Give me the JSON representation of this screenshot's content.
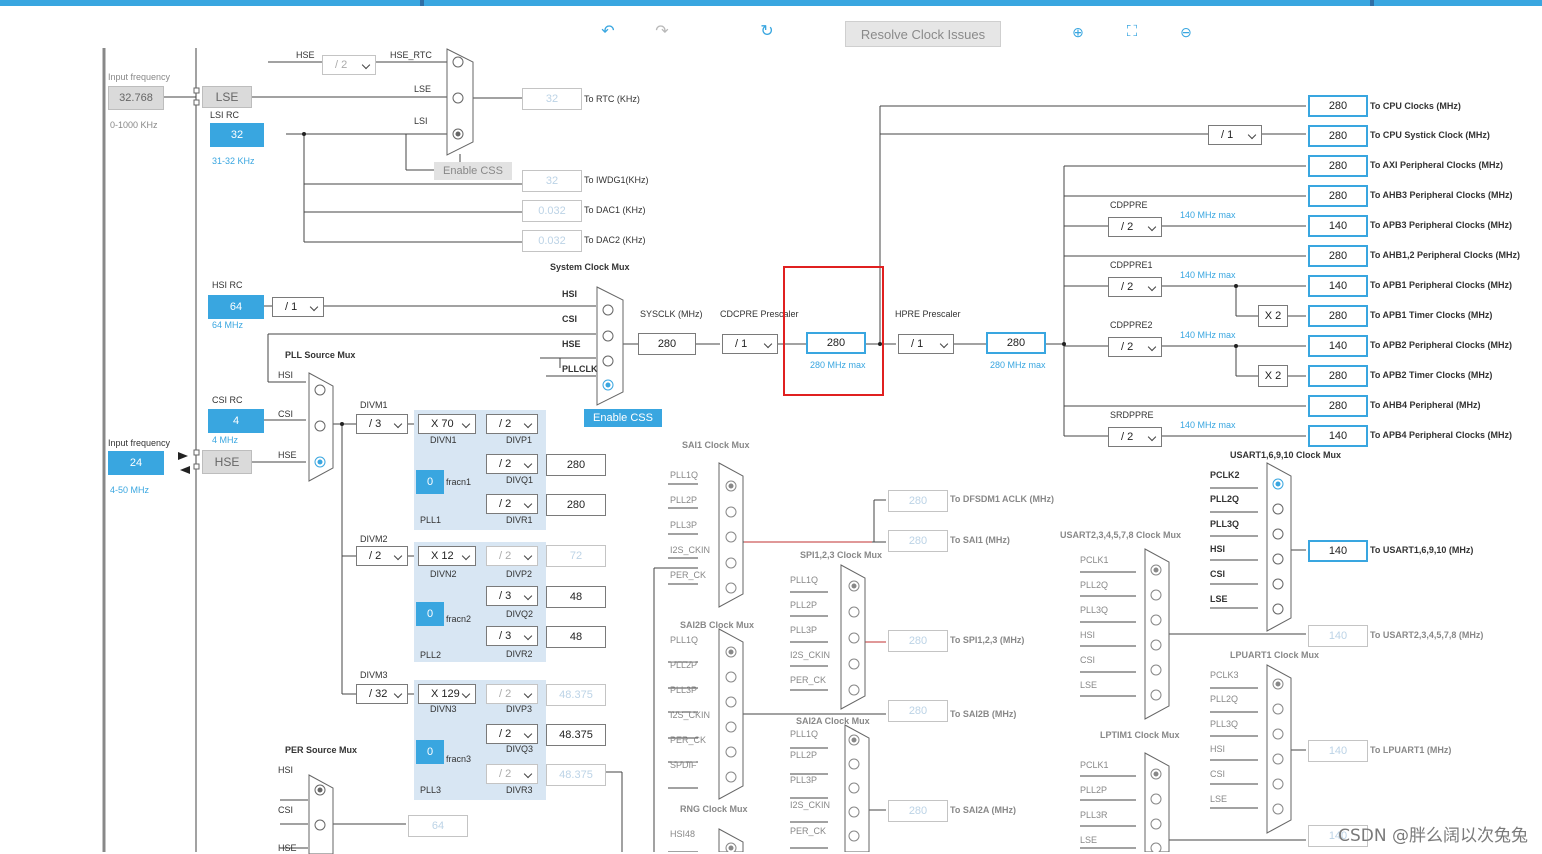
{
  "toolbar": {
    "undo_icon": "undo-icon",
    "redo_icon": "redo-icon",
    "refresh_icon": "refresh-icon",
    "resolve_label": "Resolve Clock Issues",
    "zoom_in_icon": "zoom-in-icon",
    "fit_icon": "fit-to-screen-icon",
    "zoom_out_icon": "zoom-out-icon"
  },
  "colors": {
    "accent": "#39a6e0",
    "highlight": "#e02020",
    "pll_bg": "#d8e6f3"
  },
  "lse": {
    "input_freq_label": "Input frequency",
    "value": "32.768",
    "range": "0-1000 KHz",
    "name": "LSE"
  },
  "lsi": {
    "label": "LSI RC",
    "value": "32",
    "range": "31-32 KHz"
  },
  "hse_in": {
    "input_freq_label": "Input frequency",
    "value": "24",
    "range": "4-50 MHz",
    "name": "HSE"
  },
  "hsi": {
    "label": "HSI RC",
    "value": "64",
    "range": "64 MHz",
    "div": "/ 1"
  },
  "csi": {
    "label": "CSI RC",
    "value": "4",
    "range": "4 MHz"
  },
  "rtc": {
    "hse_label": "HSE",
    "div": "/ 2",
    "hse_rtc": "HSE_RTC",
    "lse": "LSE",
    "lsi": "LSI",
    "enable_css": "Enable CSS",
    "value": "32",
    "out": "To RTC (KHz)"
  },
  "iwdg": {
    "value": "32",
    "out": "To IWDG1(KHz)"
  },
  "dac1": {
    "value": "0.032",
    "out": "To DAC1 (KHz)"
  },
  "dac2": {
    "value": "0.032",
    "out": "To DAC2 (KHz)"
  },
  "sysmux": {
    "title": "System Clock Mux",
    "in": [
      "HSI",
      "CSI",
      "HSE",
      "PLLCLK"
    ],
    "enable_css": "Enable CSS"
  },
  "sysclk": {
    "label": "SYSCLK (MHz)",
    "value": "280"
  },
  "cdcpre": {
    "label": "CDCPRE Prescaler",
    "div": "/ 1"
  },
  "cpu": {
    "value": "280",
    "max": "280 MHz max"
  },
  "hpre": {
    "label": "HPRE Prescaler",
    "div": "/ 1",
    "value": "280",
    "max": "280 MHz max"
  },
  "pllsrc": {
    "title": "PLL Source Mux",
    "in": [
      "HSI",
      "CSI",
      "HSE"
    ]
  },
  "pll1": {
    "divm_label": "DIVM1",
    "divm": "/ 3",
    "divn": "X 70",
    "divn_label": "DIVN1",
    "fracn": "0",
    "fracn_label": "fracn1",
    "name": "PLL1",
    "divp": "/ 2",
    "divp_label": "DIVP1",
    "divq": "/ 2",
    "divq_label": "DIVQ1",
    "divq_val": "280",
    "divr": "/ 2",
    "divr_label": "DIVR1",
    "divr_val": "280"
  },
  "pll2": {
    "divm_label": "DIVM2",
    "divm": "/ 2",
    "divn": "X 12",
    "divn_label": "DIVN2",
    "fracn": "0",
    "fracn_label": "fracn2",
    "name": "PLL2",
    "divp": "/ 2",
    "divp_label": "DIVP2",
    "divp_val": "72",
    "divq": "/ 3",
    "divq_label": "DIVQ2",
    "divq_val": "48",
    "divr": "/ 3",
    "divr_label": "DIVR2",
    "divr_val": "48"
  },
  "pll3": {
    "divm_label": "DIVM3",
    "divm": "/ 32",
    "divn": "X 129",
    "divn_label": "DIVN3",
    "fracn": "0",
    "fracn_label": "fracn3",
    "name": "PLL3",
    "divp": "/ 2",
    "divp_label": "DIVP3",
    "divp_val": "48.375",
    "divq": "/ 2",
    "divq_label": "DIVQ3",
    "divq_val": "48.375",
    "divr": "/ 2",
    "divr_label": "DIVR3",
    "divr_val": "48.375"
  },
  "persrc": {
    "title": "PER Source Mux",
    "in": [
      "HSI",
      "CSI",
      "HSE"
    ],
    "value": "64"
  },
  "outputs": [
    {
      "value": "280",
      "label": "To CPU Clocks (MHz)"
    },
    {
      "value": "280",
      "label": "To CPU Systick Clock (MHz)",
      "div": "/ 1"
    },
    {
      "value": "280",
      "label": "To AXI Peripheral Clocks (MHz)"
    },
    {
      "value": "280",
      "label": "To AHB3 Peripheral Clocks  (MHz)"
    },
    {
      "value": "140",
      "label": "To APB3 Peripheral Clocks (MHz)"
    },
    {
      "value": "280",
      "label": "To AHB1,2 Peripheral Clocks (MHz)"
    },
    {
      "value": "140",
      "label": "To APB1 Peripheral Clocks (MHz)"
    },
    {
      "value": "280",
      "label": "To APB1 Timer Clocks (MHz)"
    },
    {
      "value": "140",
      "label": "To APB2 Peripheral Clocks (MHz)"
    },
    {
      "value": "280",
      "label": "To APB2 Timer Clocks (MHz)"
    },
    {
      "value": "280",
      "label": "To AHB4 Peripheral (MHz)"
    },
    {
      "value": "140",
      "label": "To APB4 Peripheral Clocks (MHz)"
    }
  ],
  "prescalers": {
    "cdppre": {
      "label": "CDPPRE",
      "div": "/ 2",
      "max": "140 MHz max"
    },
    "cdppre1": {
      "label": "CDPPRE1",
      "div": "/ 2",
      "max": "140 MHz max",
      "x2": "X 2"
    },
    "cdppre2": {
      "label": "CDPPRE2",
      "div": "/ 2",
      "max": "140 MHz max",
      "x2": "X 2"
    },
    "srdppre": {
      "label": "SRDPPRE",
      "div": "/ 2",
      "max": "140 MHz max"
    }
  },
  "sai1mux": {
    "title": "SAI1 Clock Mux",
    "in": [
      "PLL1Q",
      "PLL2P",
      "PLL3P",
      "I2S_CKIN",
      "PER_CK"
    ]
  },
  "sai2bmux": {
    "title": "SAI2B Clock Mux",
    "in": [
      "PLL1Q",
      "PLL2P",
      "PLL3P",
      "I2S_CKIN",
      "PER_CK",
      "SPDIF"
    ]
  },
  "rngmux": {
    "title": "RNG Clock Mux",
    "in": [
      "HSI48"
    ]
  },
  "spimux": {
    "title": "SPI1,2,3 Clock Mux",
    "in": [
      "PLL1Q",
      "PLL2P",
      "PLL3P",
      "I2S_CKIN",
      "PER_CK"
    ]
  },
  "sai2amux": {
    "title": "SAI2A Clock Mux",
    "in": [
      "PLL1Q",
      "PLL2P",
      "PLL3P",
      "I2S_CKIN",
      "PER_CK"
    ]
  },
  "dfsdm": {
    "value": "280",
    "out": "To DFSDM1 ACLK (MHz)"
  },
  "sai1": {
    "value": "280",
    "out": "To SAI1 (MHz)"
  },
  "spi": {
    "value": "280",
    "out": "To SPI1,2,3 (MHz)"
  },
  "sai2b": {
    "value": "280",
    "out": "To SAI2B (MHz)"
  },
  "sai2a": {
    "value": "280",
    "out": "To SAI2A (MHz)"
  },
  "usart16": {
    "title": "USART1,6,9,10 Clock Mux",
    "in": [
      "PCLK2",
      "PLL2Q",
      "PLL3Q",
      "HSI",
      "CSI",
      "LSE"
    ],
    "value": "140",
    "out": "To USART1,6,9,10 (MHz)"
  },
  "usart23": {
    "title": "USART2,3,4,5,7,8 Clock Mux",
    "in": [
      "PCLK1",
      "PLL2Q",
      "PLL3Q",
      "HSI",
      "CSI",
      "LSE"
    ],
    "value": "140",
    "out": "To USART2,3,4,5,7,8 (MHz)"
  },
  "lpuart": {
    "title": "LPUART1 Clock Mux",
    "in": [
      "PCLK3",
      "PLL2Q",
      "PLL3Q",
      "HSI",
      "CSI",
      "LSE"
    ],
    "value": "140",
    "out": "To LPUART1 (MHz)"
  },
  "lptim": {
    "title": "LPTIM1 Clock Mux",
    "in": [
      "PCLK1",
      "PLL2P",
      "PLL3R",
      "LSE"
    ],
    "value": "140"
  },
  "watermark": "CSDN @胖么阔以次兔兔"
}
